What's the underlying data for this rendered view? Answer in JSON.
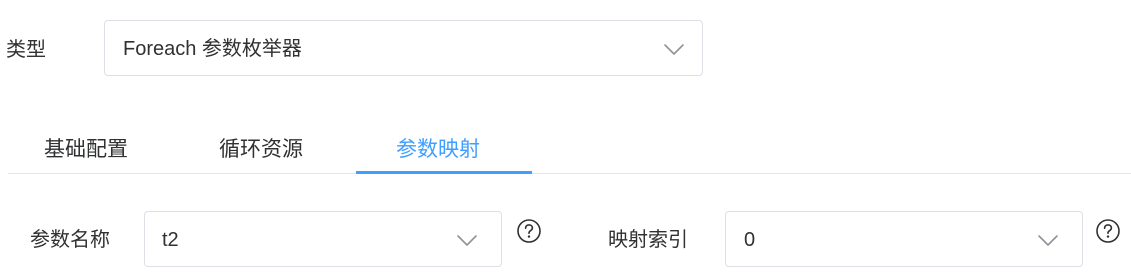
{
  "form": {
    "type_label": "类型",
    "type_value": "Foreach 参数枚举器"
  },
  "tabs": [
    {
      "label": "基础配置",
      "active": false
    },
    {
      "label": "循环资源",
      "active": false
    },
    {
      "label": "参数映射",
      "active": true
    }
  ],
  "mapping": {
    "param_name_label": "参数名称",
    "param_name_value": "t2",
    "index_label": "映射索引",
    "index_value": "0"
  },
  "icons": {
    "dropdown": "chevron-down-icon",
    "help": "question-circle-icon"
  },
  "colors": {
    "accent": "#409eff",
    "text": "#303133",
    "border": "#dcdfe6",
    "divider": "#e4e7ed"
  }
}
